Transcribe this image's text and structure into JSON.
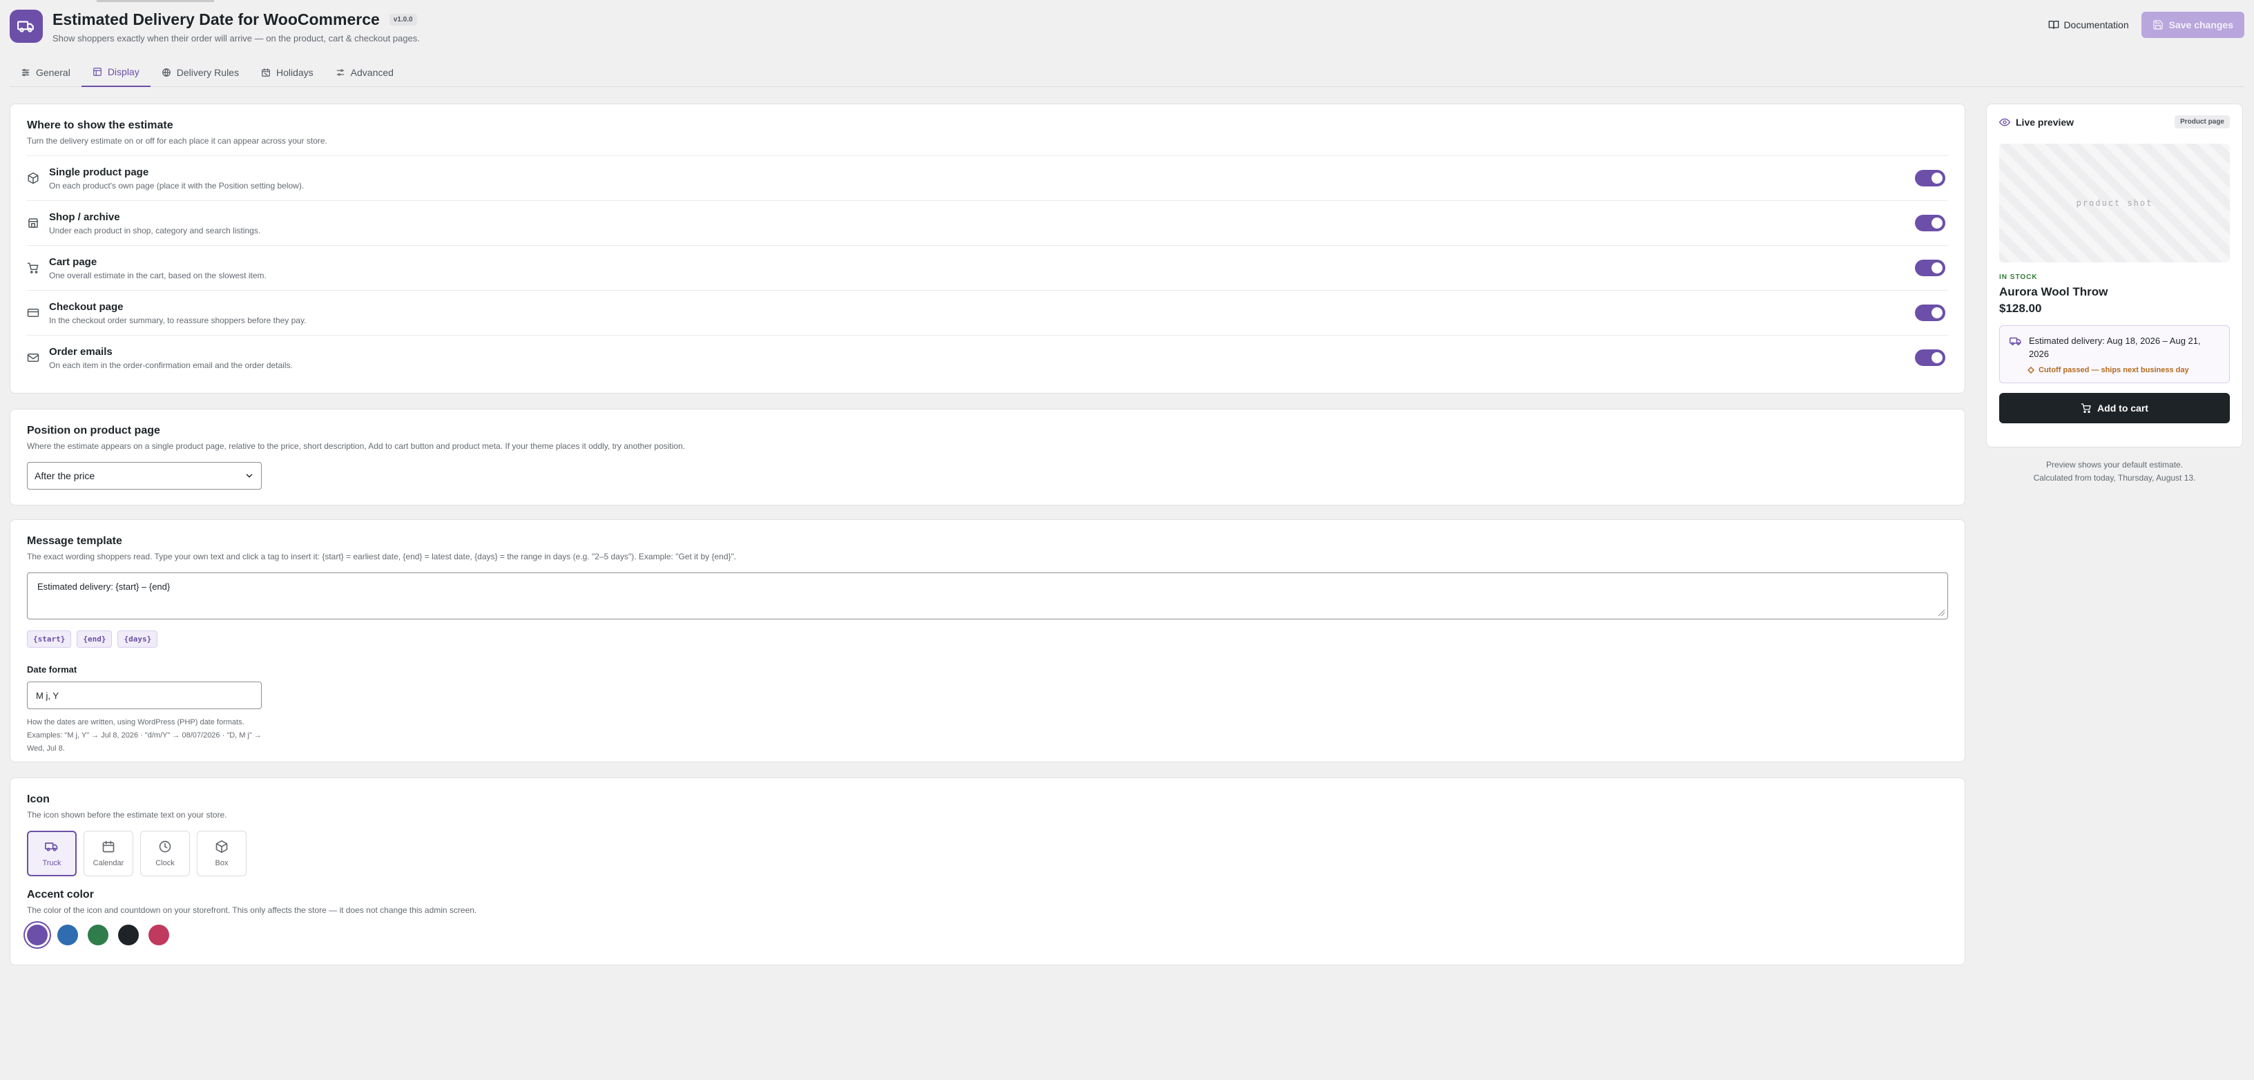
{
  "header": {
    "title": "Estimated Delivery Date for WooCommerce",
    "version": "v1.0.0",
    "subtitle": "Show shoppers exactly when their order will arrive — on the product, cart & checkout pages.",
    "documentation_label": "Documentation",
    "save_label": "Save changes",
    "accent_color": "#6c4fa8"
  },
  "tabs": [
    {
      "label": "General",
      "icon": "sliders-icon",
      "active": false
    },
    {
      "label": "Display",
      "icon": "layout-icon",
      "active": true
    },
    {
      "label": "Delivery Rules",
      "icon": "globe-icon",
      "active": false
    },
    {
      "label": "Holidays",
      "icon": "calendar-off-icon",
      "active": false
    },
    {
      "label": "Advanced",
      "icon": "settings-icon",
      "active": false
    }
  ],
  "locations": {
    "title": "Where to show the estimate",
    "description": "Turn the delivery estimate on or off for each place it can appear across your store.",
    "items": [
      {
        "label": "Single product page",
        "desc": "On each product's own page (place it with the Position setting below).",
        "icon": "package-icon",
        "enabled": true
      },
      {
        "label": "Shop / archive",
        "desc": "Under each product in shop, category and search listings.",
        "icon": "store-icon",
        "enabled": true
      },
      {
        "label": "Cart page",
        "desc": "One overall estimate in the cart, based on the slowest item.",
        "icon": "cart-icon",
        "enabled": true
      },
      {
        "label": "Checkout page",
        "desc": "In the checkout order summary, to reassure shoppers before they pay.",
        "icon": "credit-card-icon",
        "enabled": true
      },
      {
        "label": "Order emails",
        "desc": "On each item in the order-confirmation email and the order details.",
        "icon": "mail-icon",
        "enabled": true
      }
    ]
  },
  "position": {
    "title": "Position on product page",
    "description": "Where the estimate appears on a single product page, relative to the price, short description, Add to cart button and product meta. If your theme places it oddly, try another position.",
    "selected": "After the price"
  },
  "message": {
    "title": "Message template",
    "description": "The exact wording shoppers read. Type your own text and click a tag to insert it: {start} = earliest date, {end} = latest date, {days} = the range in days (e.g. \"2–5 days\"). Example: \"Get it by {end}\".",
    "template_value": "Estimated delivery: {start} – {end}",
    "tags": [
      "{start}",
      "{end}",
      "{days}"
    ],
    "date_format_label": "Date format",
    "date_format_value": "M j, Y",
    "date_format_help": "How the dates are written, using WordPress (PHP) date formats. Examples: \"M j, Y\" → Jul 8, 2026 · \"d/m/Y\" → 08/07/2026 · \"D, M j\" → Wed, Jul 8."
  },
  "icon_section": {
    "title": "Icon",
    "description": "The icon shown before the estimate text on your store.",
    "options": [
      {
        "label": "Truck",
        "icon": "truck-icon",
        "selected": true
      },
      {
        "label": "Calendar",
        "icon": "calendar-icon",
        "selected": false
      },
      {
        "label": "Clock",
        "icon": "clock-icon",
        "selected": false
      },
      {
        "label": "Box",
        "icon": "box-icon",
        "selected": false
      }
    ],
    "accent_title": "Accent color",
    "accent_description": "The color of the icon and countdown on your storefront. This only affects the store — it does not change this admin screen.",
    "colors": [
      "#6c4fa8",
      "#2f6db0",
      "#2e7d4a",
      "#1d2327",
      "#c0395f"
    ],
    "selected_color": "#6c4fa8"
  },
  "preview": {
    "title": "Live preview",
    "badge": "Product page",
    "image_placeholder": "product shot",
    "stock": "IN STOCK",
    "product_name": "Aurora Wool Throw",
    "price": "$128.00",
    "estimate": "Estimated delivery: Aug 18, 2026 – Aug 21, 2026",
    "cutoff": "Cutoff passed — ships next business day",
    "add_to_cart": "Add to cart",
    "note_line1": "Preview shows your default estimate.",
    "note_line2": "Calculated from today, Thursday, August 13."
  }
}
